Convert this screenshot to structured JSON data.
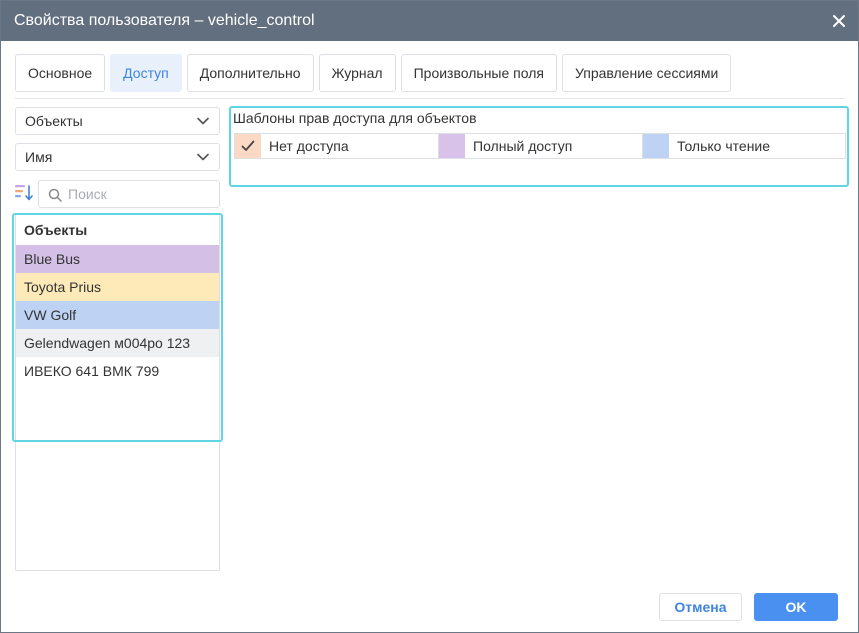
{
  "window": {
    "title": "Свойства пользователя – vehicle_control",
    "close_icon": "close-icon"
  },
  "tabs": [
    {
      "label": "Основное",
      "active": false
    },
    {
      "label": "Доступ",
      "active": true
    },
    {
      "label": "Дополнительно",
      "active": false
    },
    {
      "label": "Журнал",
      "active": false
    },
    {
      "label": "Произвольные поля",
      "active": false
    },
    {
      "label": "Управление сессиями",
      "active": false
    }
  ],
  "filters": {
    "type_select": "Объекты",
    "sort_select": "Имя",
    "search_placeholder": "Поиск",
    "search_value": ""
  },
  "object_list": {
    "header": "Объекты",
    "items": [
      {
        "label": "Blue Bus",
        "color": "#d4bfe6"
      },
      {
        "label": "Toyota Prius",
        "color": "#fdeab8"
      },
      {
        "label": "VW Golf",
        "color": "#bed3f3"
      },
      {
        "label": "Gelendwagen м004ро 123",
        "color": "#eef0f2"
      },
      {
        "label": "ИВЕКО 641 ВМК 799",
        "color": "#ffffff"
      }
    ]
  },
  "access_templates": {
    "title": "Шаблоны прав доступа для объектов",
    "items": [
      {
        "label": "Нет доступа",
        "color": "#fbd9c4",
        "checked": true
      },
      {
        "label": "Полный доступ",
        "color": "#d8c2ea",
        "checked": false
      },
      {
        "label": "Только чтение",
        "color": "#bed3f3",
        "checked": false
      }
    ]
  },
  "buttons": {
    "cancel": "Отмена",
    "ok": "OK"
  },
  "colors": {
    "titlebar": "#616f7e",
    "accent": "#4a90f0",
    "highlight_border": "#5fd6e2"
  }
}
